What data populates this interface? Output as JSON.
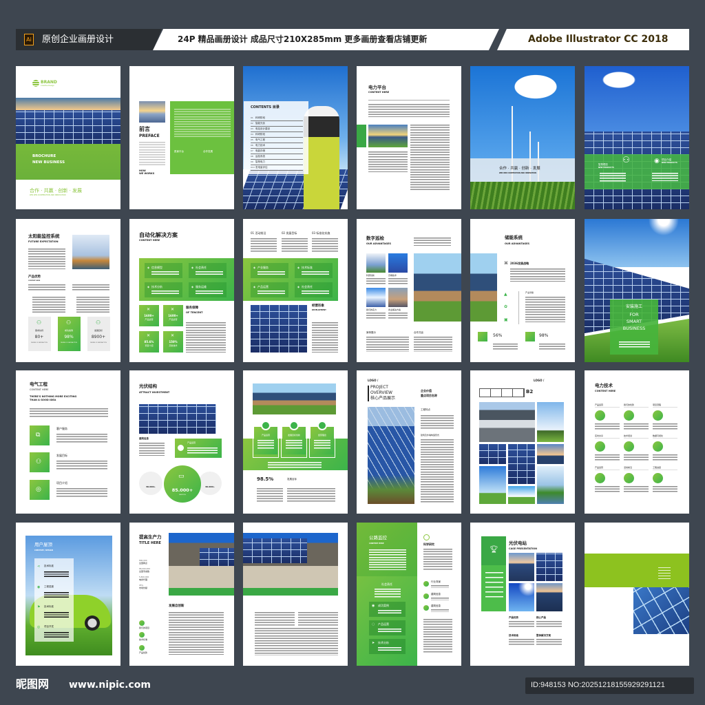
{
  "header": {
    "ai_badge": "Ai",
    "left_title": "原创企业画册设计",
    "middle_text": "24P 精品画册设计 成品尺寸210X285mm 更多画册查看店铺更新",
    "right_text": "Adobe Illustrator CC 2018"
  },
  "footer": {
    "site_logo": "昵图网",
    "site_url": "www.nipic.com",
    "id_text": "ID:948153 NO:20251218155929291121"
  },
  "colors": {
    "background": "#3e4650",
    "brand_green": "#3cb44a",
    "lime": "#8cc63f",
    "ai_orange": "#f7a21b"
  },
  "pages": {
    "p1": {
      "brand": "BRAND",
      "brand_sub": "Creative Design",
      "title1": "BROCHURE",
      "title2": "NEW BUSINESS",
      "slogan": "合作 · 共赢 · 创新 · 发展",
      "slogan_en": "WIN WIN COOPERATION AND INNOVATION"
    },
    "p2": {
      "title_cn": "前言",
      "title_en": "PREFACE",
      "how": "HOW",
      "we_works": "WE WORKS",
      "item1": "愿景平台",
      "item2": "合作发展"
    },
    "p3": {
      "title": "CONTENTS 目录",
      "items": [
        "科研阶段",
        "智能光伏",
        "电站设计建设",
        "科研阶段",
        "电气工程",
        "电力技术",
        "电能存储",
        "运检系统",
        "智慧电力",
        "发电量评估"
      ]
    },
    "p4": {
      "title_cn": "电力平台",
      "title_en": "CONTENT HERE"
    },
    "p5": {
      "slogan": "合作 · 共赢 · 创新 · 发展",
      "slogan_en": "WIN WIN COOPERATION AND INNOVATION"
    },
    "p6": {
      "left_cn": "智慧理念",
      "left_en": "NEW PRODUCTS",
      "right_cn": "项目介绍",
      "right_en": "NEW PRODUCTS"
    },
    "p7": {
      "title_cn": "太阳能监控系统",
      "title_en": "FUTURE EXPECTATION",
      "sub_cn": "产品优势",
      "sub_en": "CONTENT HERE",
      "stats": [
        {
          "label": "需求扶持",
          "value": "80+"
        },
        {
          "label": "成功案例",
          "value": "98%"
        },
        {
          "label": "发展目标",
          "value": "8900+"
        }
      ],
      "stat_note": "DEGREE OF SATISFACTION"
    },
    "p8": {
      "title_cn": "自动化解决方案",
      "title_en": "CONTENT HERE",
      "tiles": [
        "信息模型",
        "社会责任",
        "技术分析",
        "服务运维"
      ],
      "boxes": [
        {
          "value": "1600+",
          "label": "产品运营"
        },
        {
          "value": "1600+",
          "label": "产品运营"
        },
        {
          "value": "85.6%",
          "label": "项目介绍"
        },
        {
          "value": "150%",
          "label": "高新技术"
        }
      ],
      "side_cn": "服务保障",
      "side_en": "OF TENCENT"
    },
    "p9": {
      "cols": [
        "01 活动前沿",
        "02 发展目标",
        "03 标准化实施"
      ],
      "tiles": [
        "产业服务",
        "技术标准",
        "产品运营",
        "社会责任"
      ],
      "side_cn": "经营形象",
      "side_en": "DEVELOPMENT"
    },
    "p10": {
      "title_cn": "数字巡检",
      "title_en": "OUR ADVANTAGES",
      "thumbs": [
        "科研创新",
        "高端技术",
        "我们的实力",
        "商业解决方案"
      ],
      "bottom1": "案例展示",
      "bottom2": "合作共赢"
    },
    "p11": {
      "title_cn": "储能系统",
      "title_en": "OUR ADVANTAGES",
      "strategy": "2036发展战略",
      "sub": "产业管联",
      "stat1": "56%",
      "stat2": "98%"
    },
    "p12": {
      "line1": "安装施工",
      "line2": "FOR",
      "line3": "SMART",
      "line4": "BUSINESS"
    },
    "p13": {
      "title_cn": "电气工程",
      "title_en": "CONTENT HERE",
      "tagline1": "THERE'S NOTHING MORE EXCITING",
      "tagline2": "THAN A GOOD IDEA",
      "items": [
        "客户服务",
        "发展目标",
        "项目介绍"
      ]
    },
    "p14": {
      "title_cn": "光伏结构",
      "title_en": "ATTRACT INVESTMENT",
      "info": "建筑信息",
      "box": "产品运营",
      "big_value": "85.000+",
      "small_value": "30.000+",
      "services": "SERVICES"
    },
    "p15": {
      "cards": [
        "产品运营",
        "发展目标创新",
        "经营理念"
      ],
      "stat": "98.5%",
      "stat_label": "发展目标"
    },
    "p16": {
      "logo": "LOGO /",
      "line1": "PROJECT",
      "line2": "OVERVIEW",
      "line3": "核心产品展示",
      "right1": "企业价值",
      "right2": "重点项目名称",
      "feature": "工程特点",
      "structure": "建筑及外墙构造形式"
    },
    "p17": {
      "logo": "LOGO /",
      "code": "B2"
    },
    "p18": {
      "title_cn": "电力技术",
      "title_en": "CONTENT HERE",
      "items": [
        "产品运营",
        "我们的优势",
        "项目流程",
        "实时共享",
        "技术培训",
        "数据可视化",
        "产品运营",
        "活动前沿",
        "工程进度"
      ]
    },
    "p19": {
      "title_cn": "用户屋顶",
      "title_en": "CREATIVE / DESIGN",
      "items": [
        "技术标准",
        "工程进度",
        "技术标准",
        "项目开发"
      ]
    },
    "p20": {
      "title_cn": "提高生产力",
      "title_en": "TITLE HERE",
      "stats": [
        {
          "value": "800,000",
          "label": "全国网点"
        },
        {
          "value": "86,000,000",
          "label": "全国专案数"
        },
        {
          "value": "5,800,000",
          "label": "电商代理"
        },
        {
          "value": "95%",
          "label": "市场份额"
        }
      ],
      "heading": "发展自创新",
      "circles": [
        "我们的项目",
        "技术标准",
        "产品优势"
      ]
    },
    "p22": {
      "title_cn": "公路监控",
      "title_en": "CONTENT HERE",
      "mid": "社会责任",
      "tiles": [
        "成功案例",
        "产品运营",
        "技术分析"
      ],
      "right_title": "科学研究",
      "right_items": [
        "行业背景",
        "建筑信息",
        "建筑信息"
      ]
    },
    "p23": {
      "title_cn": "光伏电站",
      "title_en": "CASE PRESENTATION",
      "labels": [
        "产品优势",
        "核心产品",
        "技术标准",
        "整体解决方案"
      ]
    }
  }
}
